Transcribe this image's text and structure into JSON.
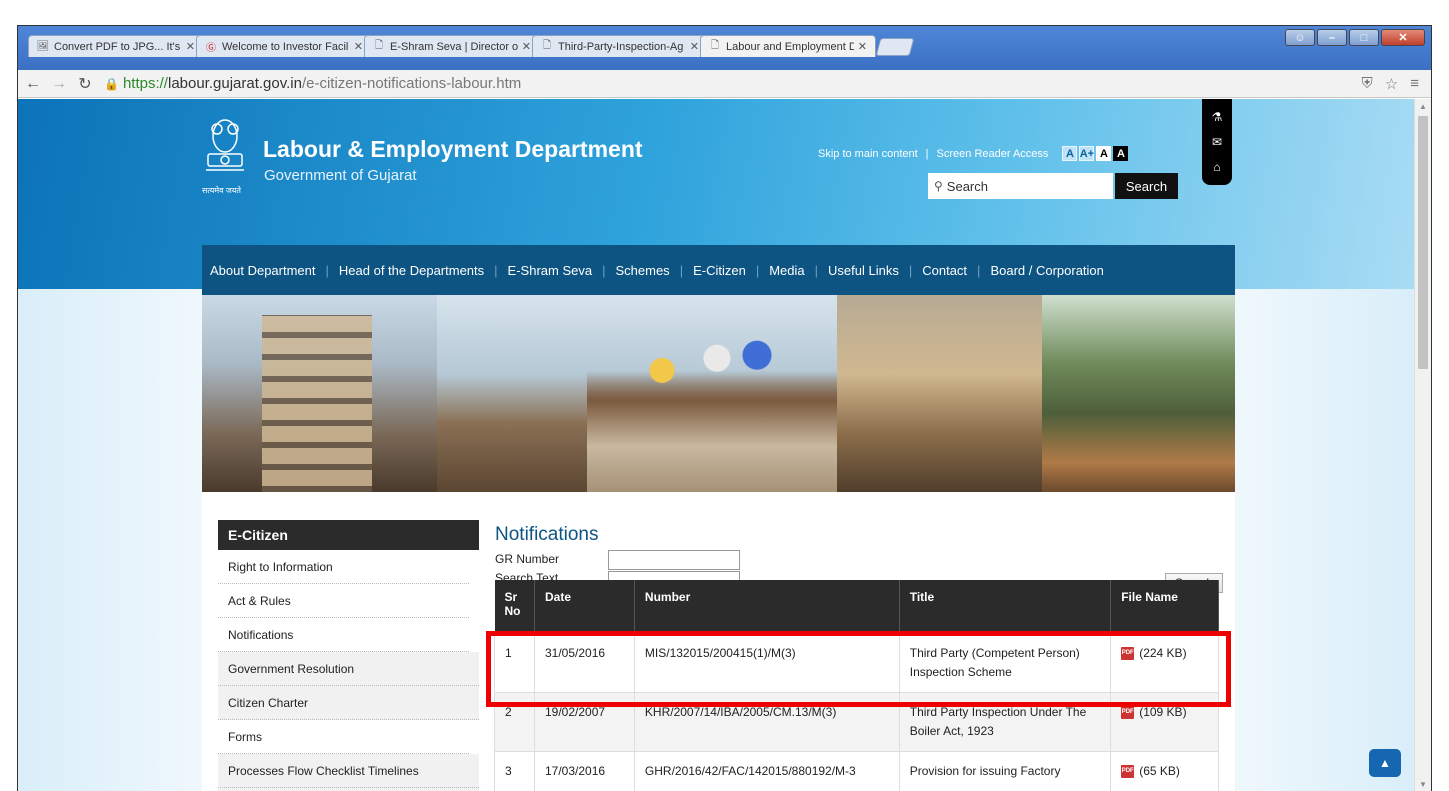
{
  "browser": {
    "tabs": [
      {
        "label": "Convert PDF to JPG... It's o",
        "icon": "image-icon"
      },
      {
        "label": "Welcome to Investor Facil",
        "icon": "pinterest-icon"
      },
      {
        "label": "E-Shram Seva | Director of",
        "icon": "page-icon"
      },
      {
        "label": "Third-Party-Inspection-Ag",
        "icon": "page-icon"
      },
      {
        "label": "Labour and Employment D",
        "icon": "page-icon",
        "active": true
      }
    ],
    "url_proto": "https://",
    "url_host": "labour.gujarat.gov.in",
    "url_path": "/e-citizen-notifications-labour.htm"
  },
  "header": {
    "title": "Labour & Employment Department",
    "subtitle": "Government of Gujarat",
    "motto": "सत्यमेव जयते",
    "skip_link": "Skip to main content",
    "screen_reader": "Screen Reader Access",
    "font_a": "A",
    "font_a_plus": "A+",
    "font_a_white": "A",
    "font_a_black": "A",
    "search_placeholder": "Search",
    "search_button": "Search"
  },
  "menu": [
    "About Department",
    "Head of the Departments",
    "E-Shram Seva",
    "Schemes",
    "E-Citizen",
    "Media",
    "Useful Links",
    "Contact",
    "Board / Corporation"
  ],
  "sidebar": {
    "heading": "E-Citizen",
    "items": [
      "Right to Information",
      "Act & Rules",
      "Notifications",
      "Government Resolution",
      "Citizen Charter",
      "Forms",
      "Processes Flow Checklist Timelines",
      "Inspection"
    ]
  },
  "main": {
    "heading": "Notifications",
    "gr_label": "GR Number",
    "search_label": "Search Text",
    "search_button": "Search",
    "columns": [
      "Sr No",
      "Date",
      "Number",
      "Title",
      "File Name"
    ],
    "rows": [
      {
        "sr": "1",
        "date": "31/05/2016",
        "number": "MIS/132015/200415(1)/M(3)",
        "title": "Third Party (Competent Person) Inspection Scheme",
        "file": "(224 KB)"
      },
      {
        "sr": "2",
        "date": "19/02/2007",
        "number": "KHR/2007/14/IBA/2005/CM.13/M(3)",
        "title": "Third Party Inspection Under The Boiler Act, 1923",
        "file": "(109 KB)"
      },
      {
        "sr": "3",
        "date": "17/03/2016",
        "number": "GHR/2016/42/FAC/142015/880192/M-3",
        "title": "Provision for issuing Factory",
        "file": "(65 KB)"
      }
    ],
    "pdf_icon_text": "PDF"
  },
  "colors": {
    "menu_bg": "#0d5482",
    "highlight": "#ee0000",
    "table_header": "#2b2b2b"
  }
}
